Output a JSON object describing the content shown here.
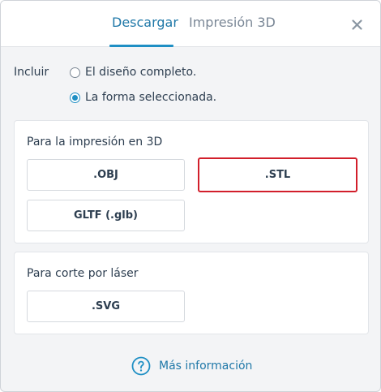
{
  "tabs": {
    "download": "Descargar",
    "print3d": "Impresión 3D"
  },
  "include": {
    "label": "Incluir",
    "options": [
      {
        "label": "El diseño completo.",
        "checked": false
      },
      {
        "label": "La forma seleccionada.",
        "checked": true
      }
    ]
  },
  "print3d_section": {
    "title": "Para la impresión en 3D",
    "formats": [
      ".OBJ",
      ".STL",
      "GLTF (.glb)"
    ]
  },
  "laser_section": {
    "title": "Para corte por láser",
    "formats": [
      ".SVG"
    ]
  },
  "more_info": "Más información",
  "colors": {
    "accent": "#1f8fc4",
    "link": "#1f78a8",
    "highlight": "#d21f2b"
  },
  "icons": [
    "close-icon",
    "question-circle-icon"
  ]
}
